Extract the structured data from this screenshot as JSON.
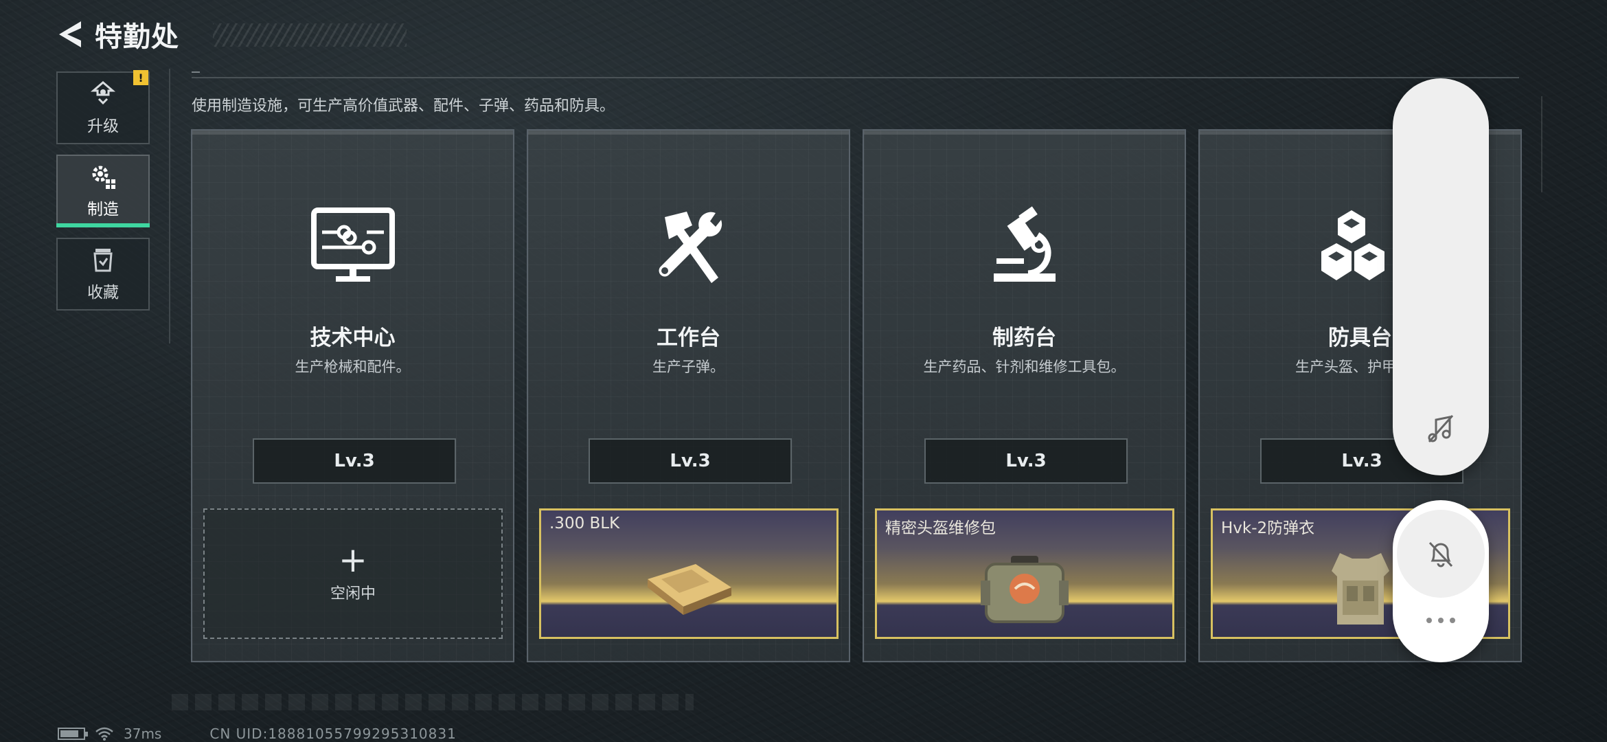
{
  "header": {
    "title": "特勤处"
  },
  "sidebar": {
    "items": [
      {
        "label": "升级",
        "badge": "!"
      },
      {
        "label": "制造"
      },
      {
        "label": "收藏"
      }
    ]
  },
  "description": "使用制造设施，可生产高价值武器、配件、子弹、药品和防具。",
  "cards": [
    {
      "name": "技术中心",
      "desc": "生产枪械和配件。",
      "level": "Lv.3",
      "slot_status": "空闲中",
      "icon": "computer-icon"
    },
    {
      "name": "工作台",
      "desc": "生产子弹。",
      "level": "Lv.3",
      "product": ".300 BLK",
      "icon": "hammer-wrench-icon"
    },
    {
      "name": "制药台",
      "desc": "生产药品、针剂和维修工具包。",
      "level": "Lv.3",
      "product": "精密头盔维修包",
      "icon": "microscope-icon"
    },
    {
      "name": "防具台",
      "desc": "生产头盔、护甲、胸",
      "level": "Lv.3",
      "product": "Hvk-2防弹衣",
      "icon": "armor-blocks-icon"
    }
  ],
  "footer": {
    "ping": "37ms",
    "uid": "CN UID:18881055799295310831"
  },
  "colors": {
    "accent": "#3fd6a0",
    "product_border": "#d8c160",
    "badge": "#f1c232"
  }
}
